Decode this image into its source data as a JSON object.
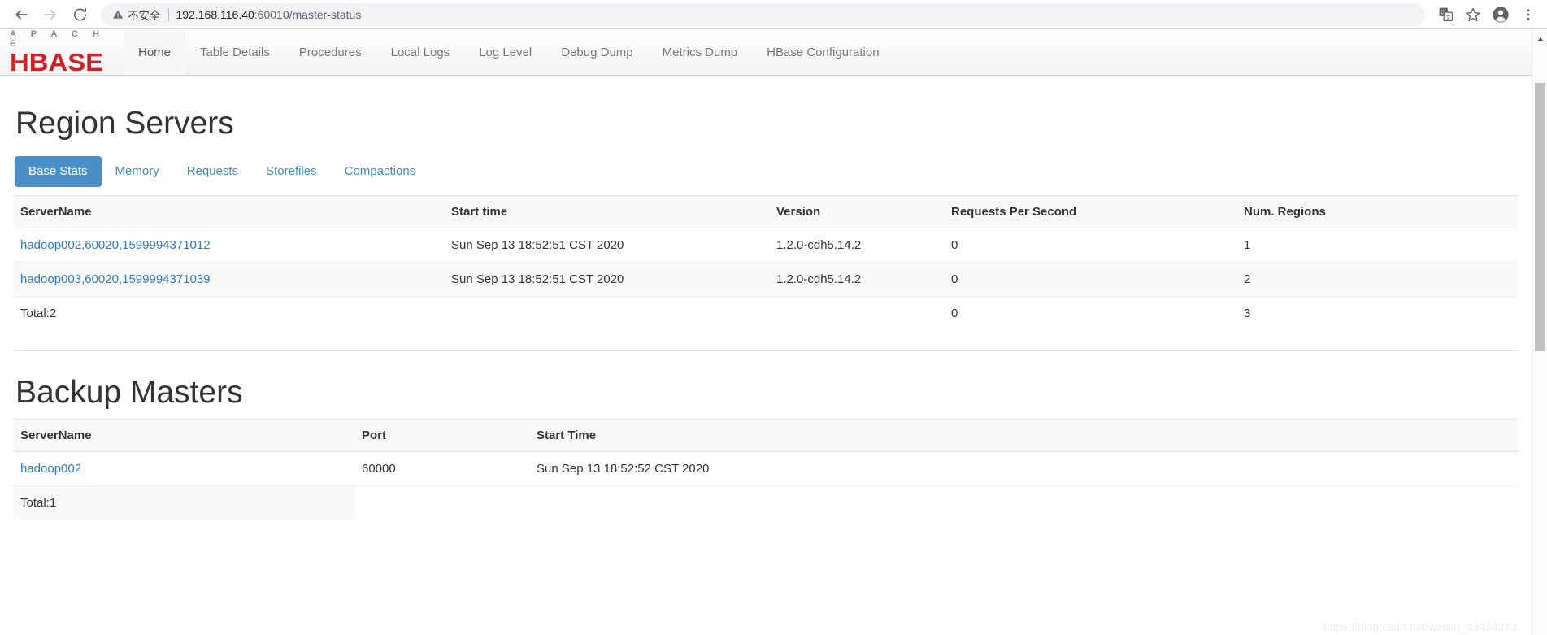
{
  "browser": {
    "back_icon": "arrow-left-icon",
    "forward_icon": "arrow-right-icon",
    "reload_icon": "reload-icon",
    "security_warning_label": "不安全",
    "url_host": "192.168.116.40",
    "url_rest": ":60010/master-status",
    "url_full": "192.168.116.40:60010/master-status",
    "actions": [
      {
        "name": "translate-icon",
        "label": "Translate"
      },
      {
        "name": "bookmark-star-icon",
        "label": "Bookmark"
      },
      {
        "name": "profile-avatar-icon",
        "label": "Profile"
      },
      {
        "name": "more-menu-icon",
        "label": "Customize and control"
      }
    ]
  },
  "brand": {
    "apache": "A P A C H E",
    "hbase": "HBASE"
  },
  "navbar": {
    "items": [
      {
        "label": "Home",
        "active": true
      },
      {
        "label": "Table Details",
        "active": false
      },
      {
        "label": "Procedures",
        "active": false
      },
      {
        "label": "Local Logs",
        "active": false
      },
      {
        "label": "Log Level",
        "active": false
      },
      {
        "label": "Debug Dump",
        "active": false
      },
      {
        "label": "Metrics Dump",
        "active": false
      },
      {
        "label": "HBase Configuration",
        "active": false
      }
    ]
  },
  "region_servers": {
    "title": "Region Servers",
    "tabs": [
      {
        "label": "Base Stats",
        "active": true
      },
      {
        "label": "Memory",
        "active": false
      },
      {
        "label": "Requests",
        "active": false
      },
      {
        "label": "Storefiles",
        "active": false
      },
      {
        "label": "Compactions",
        "active": false
      }
    ],
    "columns": [
      "ServerName",
      "Start time",
      "Version",
      "Requests Per Second",
      "Num. Regions"
    ],
    "rows": [
      {
        "server_name": "hadoop002,60020,1599994371012",
        "start_time": "Sun Sep 13 18:52:51 CST 2020",
        "version": "1.2.0-cdh5.14.2",
        "requests_per_second": "0",
        "num_regions": "1"
      },
      {
        "server_name": "hadoop003,60020,1599994371039",
        "start_time": "Sun Sep 13 18:52:51 CST 2020",
        "version": "1.2.0-cdh5.14.2",
        "requests_per_second": "0",
        "num_regions": "2"
      }
    ],
    "total": {
      "label": "Total:2",
      "start_time": "",
      "version": "",
      "requests_per_second": "0",
      "num_regions": "3"
    }
  },
  "backup_masters": {
    "title": "Backup Masters",
    "columns": [
      "ServerName",
      "Port",
      "Start Time"
    ],
    "rows": [
      {
        "server_name": "hadoop002",
        "port": "60000",
        "start_time": "Sun Sep 13 18:52:52 CST 2020"
      }
    ],
    "total": {
      "label": "Total:1",
      "port": "",
      "start_time": ""
    }
  },
  "watermark": "https://blog.csdn.net/weixin_43434273",
  "colors": {
    "brand_red": "#cc2229",
    "link_blue": "#337ab7",
    "tab_active_bg": "#4a90c4",
    "tab_text": "#3c8dbc"
  }
}
